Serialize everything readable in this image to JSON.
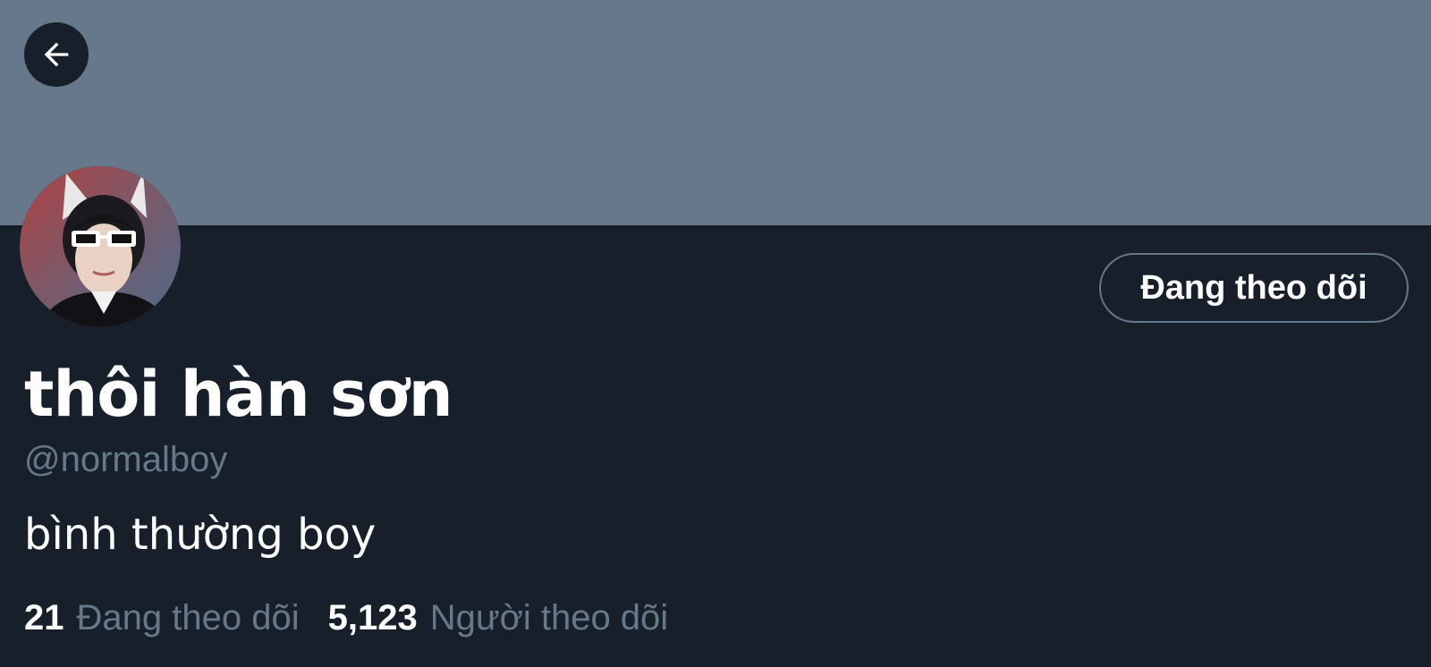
{
  "profile": {
    "display_name": "thôi hàn sơn",
    "handle": "@normalboy",
    "bio": "bình thường boy",
    "follow_button_label": "Đang theo dõi",
    "stats": [
      {
        "count": "21",
        "label": "Đang theo dõi"
      },
      {
        "count": "5,123",
        "label": "Người theo dõi"
      }
    ]
  },
  "icons": {
    "back": "arrow-left-icon"
  },
  "colors": {
    "banner": "#66788a",
    "background": "#17202a",
    "muted_text": "#66788a",
    "primary_text": "#ffffff"
  }
}
